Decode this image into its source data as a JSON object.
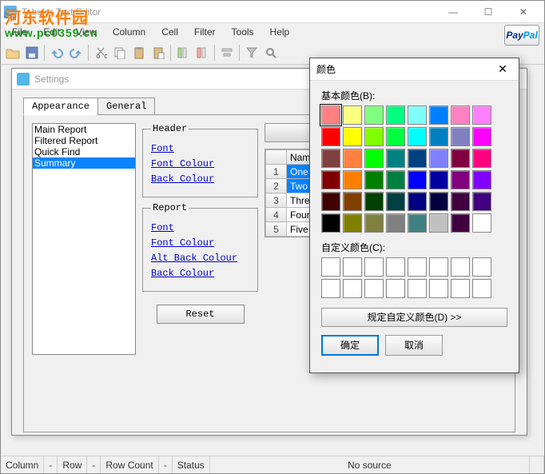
{
  "main_window": {
    "title": "Tabular Text Editor",
    "win_buttons": {
      "min": "—",
      "max": "☐",
      "close": "✕"
    }
  },
  "menubar": {
    "items": [
      "File",
      "Edit",
      "View",
      "Column",
      "Cell",
      "Filter",
      "Tools",
      "Help"
    ],
    "paypal1": "Pay",
    "paypal2": "Pal"
  },
  "watermark": {
    "line1": "河东软件园",
    "line2": "www.pc0359.cn"
  },
  "settings": {
    "title": "Settings",
    "win_close": "✕",
    "tabs": {
      "appearance": "Appearance",
      "general": "General"
    },
    "list": [
      "Main Report",
      "Filtered Report",
      "Quick Find",
      "Summary"
    ],
    "selected_index": 3,
    "header_group": "Header",
    "report_group": "Report",
    "links": {
      "font": "Font",
      "font_colour": "Font Colour",
      "back_colour": "Back Colour",
      "alt_back_colour": "Alt Back Colour"
    },
    "reset": "Reset",
    "grid": {
      "col_header": "Name",
      "rows": [
        "One",
        "Two",
        "Three",
        "Four",
        "Five"
      ]
    }
  },
  "color_dialog": {
    "title": "颜色",
    "close": "✕",
    "basic_label": "基本颜色(B):",
    "custom_label": "自定义颜色(C):",
    "define_btn": "规定自定义颜色(D) >>",
    "ok": "确定",
    "cancel": "取消",
    "selected_color": "#ff8080",
    "basic_colors": [
      "#ff8080",
      "#ffff80",
      "#80ff80",
      "#00ff80",
      "#80ffff",
      "#0080ff",
      "#ff80c0",
      "#ff80ff",
      "#ff0000",
      "#ffff00",
      "#80ff00",
      "#00ff40",
      "#00ffff",
      "#0080c0",
      "#8080c0",
      "#ff00ff",
      "#804040",
      "#ff8040",
      "#00ff00",
      "#008080",
      "#004080",
      "#8080ff",
      "#800040",
      "#ff0080",
      "#800000",
      "#ff8000",
      "#008000",
      "#008040",
      "#0000ff",
      "#0000a0",
      "#800080",
      "#8000ff",
      "#400000",
      "#804000",
      "#004000",
      "#004040",
      "#000080",
      "#000040",
      "#400040",
      "#400080",
      "#000000",
      "#808000",
      "#808040",
      "#808080",
      "#408080",
      "#c0c0c0",
      "#400040",
      "#ffffff"
    ]
  },
  "status": {
    "column_label": "Column",
    "row_label": "Row",
    "rowcount_label": "Row Count",
    "status_label": "Status",
    "dash": "-",
    "source": "No source"
  }
}
